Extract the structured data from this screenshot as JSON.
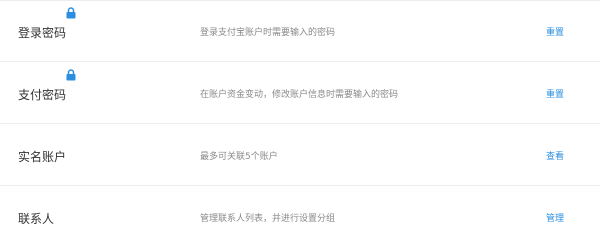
{
  "settings": {
    "rows": [
      {
        "label": "登录密码",
        "description": "登录支付宝账户时需要输入的密码",
        "action": "重置",
        "locked": true
      },
      {
        "label": "支付密码",
        "description": "在账户资金变动，修改账户信息时需要输入的密码",
        "action": "重置",
        "locked": true
      },
      {
        "label": "实名账户",
        "description": "最多可关联5个账户",
        "action": "查看",
        "locked": false
      },
      {
        "label": "联系人",
        "description": "管理联系人列表，并进行设置分组",
        "action": "管理",
        "locked": false
      }
    ]
  },
  "colors": {
    "label": "#333333",
    "description": "#8a8a8a",
    "action": "#2a8fe0",
    "lock": "#2a8fe0",
    "divider": "#ececec"
  },
  "icons": {
    "lock": "lock-icon"
  }
}
